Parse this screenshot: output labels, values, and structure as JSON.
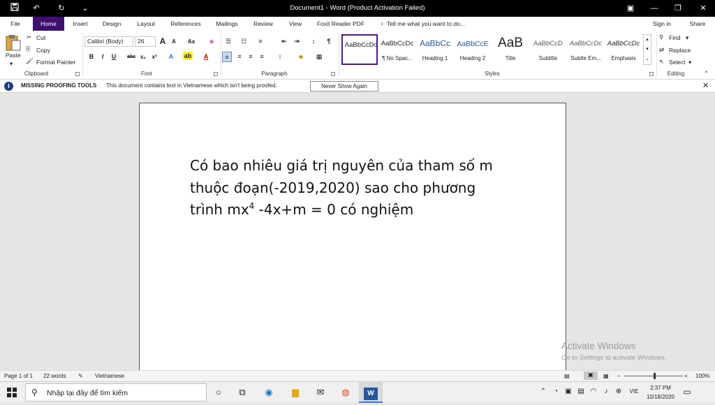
{
  "titlebar": {
    "title": "Document1 - Word (Product Activation Failed)",
    "save_icon": "save-icon",
    "undo_icon": "undo-icon",
    "redo_icon": "redo-icon",
    "customize_icon": "customize-qat-icon"
  },
  "tabs": [
    "File",
    "Home",
    "Insert",
    "Design",
    "Layout",
    "References",
    "Mailings",
    "Review",
    "View",
    "Foxit Reader PDF"
  ],
  "tell_me": "Tell me what you want to do...",
  "sign_in": "Sign in",
  "share": "Share",
  "clipboard": {
    "paste": "Paste",
    "cut": "Cut",
    "copy": "Copy",
    "format_painter": "Format Painter",
    "label": "Clipboard"
  },
  "font": {
    "name": "Calibri (Body)",
    "size": "26",
    "label": "Font"
  },
  "paragraph": {
    "label": "Paragraph"
  },
  "styles": {
    "label": "Styles",
    "items": [
      {
        "preview": "AaBbCcDc",
        "name": ""
      },
      {
        "preview": "AaBbCcDc",
        "name": "¶ No Spac..."
      },
      {
        "preview": "AaBbCc",
        "name": "Heading 1"
      },
      {
        "preview": "AaBbCcE",
        "name": "Heading 2"
      },
      {
        "preview": "AaB",
        "name": "Title"
      },
      {
        "preview": "AaBbCcD",
        "name": "Subtitle"
      },
      {
        "preview": "AaBbCcDc",
        "name": "Subtle Em..."
      },
      {
        "preview": "AaBbCcDc",
        "name": "Emphasis"
      }
    ]
  },
  "editing": {
    "find": "Find",
    "replace": "Replace",
    "select": "Select",
    "label": "Editing"
  },
  "message_bar": {
    "title": "MISSING PROOFING TOOLS",
    "text": "This document contains text in Vietnamese which isn't being proofed.",
    "button": "Never Show Again"
  },
  "document": {
    "line1": "Có bao nhiêu giá trị nguyên của tham số m",
    "line2": "thuộc đoạn(-2019,2020) sao cho phương",
    "line3_before": "trình mx",
    "line3_sup": "4",
    "line3_after": " -4x+m = 0 có nghiệm"
  },
  "activate_windows": {
    "title": "Activate Windows",
    "subtitle": "Go to Settings to activate Windows."
  },
  "statusbar": {
    "page": "Page 1 of 1",
    "words": "22 words",
    "language": "Vietnamese",
    "zoom": "100%"
  },
  "taskbar": {
    "search_placeholder": "Nhập tại đây để tìm kiếm",
    "time": "2:37 PM",
    "date": "10/18/2020",
    "lang": "VIE"
  },
  "colors": {
    "accent": "#3f0f6e",
    "titlebar": "#000000"
  }
}
